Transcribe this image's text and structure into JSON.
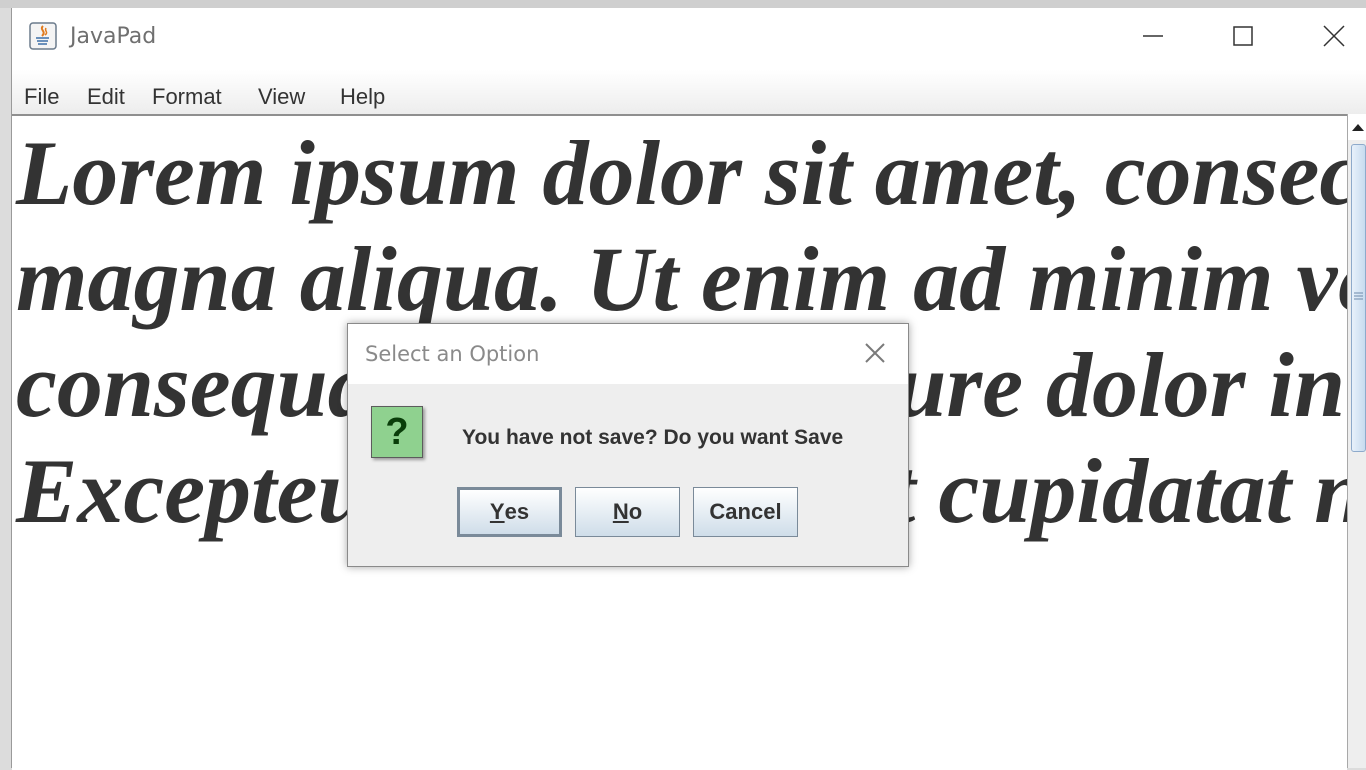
{
  "window": {
    "title": "JavaPad",
    "controls": [
      "minimize",
      "maximize",
      "close"
    ]
  },
  "menubar": {
    "items": [
      {
        "label": "File"
      },
      {
        "label": "Edit"
      },
      {
        "label": "Format"
      },
      {
        "label": "View"
      },
      {
        "label": "Help"
      }
    ]
  },
  "editor": {
    "lines": [
      "Lorem ipsum dolor sit amet, consectetur adipiscing elit, sed do eiusmod tempor incididunt ut labore et dolore",
      "magna aliqua. Ut enim ad minim veniam, quis nostrud exercitation ullamco laboris nisi ut aliquip ex ea commodo",
      "consequat. Duis aute irure dolor in reprehenderit in voluptate velit esse cillum dolore eu fugiat nulla pariatur.",
      "Excepteur sint occaecat cupidatat non proident, sunt in culpa qui officia deserunt mollit anim id est laborum."
    ],
    "font_style": "bold italic serif",
    "text_color": "#333333"
  },
  "dialog": {
    "title": "Select an Option",
    "message": "You have not save? Do you want Save",
    "icon": "question-icon",
    "icon_glyph": "?",
    "buttons": {
      "yes": {
        "mnemonic": "Y",
        "rest": "es"
      },
      "no": {
        "mnemonic": "N",
        "rest": "o"
      },
      "cancel": {
        "label": "Cancel"
      }
    },
    "focused_button": "yes"
  },
  "colors": {
    "icon_green": "#8fd18f",
    "button_gradient_bottom": "#cfdde9",
    "scroll_thumb": "#c7dbef"
  }
}
